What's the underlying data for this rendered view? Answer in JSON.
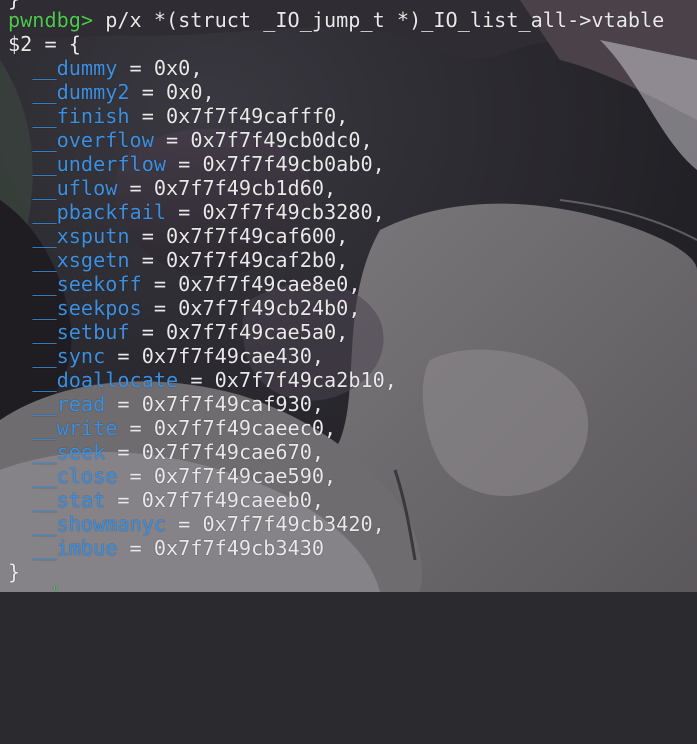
{
  "terminal": {
    "top_partial": "}",
    "prompt": "pwndbg>",
    "command": "p/x *(struct _IO_jump_t *)_IO_list_all->vtable",
    "result_open": "$2 = {",
    "fields": [
      {
        "name": "__dummy",
        "value": "0x0,"
      },
      {
        "name": "__dummy2",
        "value": "0x0,"
      },
      {
        "name": "__finish",
        "value": "0x7f7f49cafff0,"
      },
      {
        "name": "__overflow",
        "value": "0x7f7f49cb0dc0,"
      },
      {
        "name": "__underflow",
        "value": "0x7f7f49cb0ab0,"
      },
      {
        "name": "__uflow",
        "value": "0x7f7f49cb1d60,"
      },
      {
        "name": "__pbackfail",
        "value": "0x7f7f49cb3280,"
      },
      {
        "name": "__xsputn",
        "value": "0x7f7f49caf600,"
      },
      {
        "name": "__xsgetn",
        "value": "0x7f7f49caf2b0,"
      },
      {
        "name": "__seekoff",
        "value": "0x7f7f49cae8e0,"
      },
      {
        "name": "__seekpos",
        "value": "0x7f7f49cb24b0,"
      },
      {
        "name": "__setbuf",
        "value": "0x7f7f49cae5a0,"
      },
      {
        "name": "__sync",
        "value": "0x7f7f49cae430,"
      },
      {
        "name": "__doallocate",
        "value": "0x7f7f49ca2b10,"
      },
      {
        "name": "__read",
        "value": "0x7f7f49caf930,"
      },
      {
        "name": "__write",
        "value": "0x7f7f49caeec0,"
      },
      {
        "name": "__seek",
        "value": "0x7f7f49cae670,"
      },
      {
        "name": "__close",
        "value": "0x7f7f49cae590,"
      },
      {
        "name": "__stat",
        "value": "0x7f7f49caeeb0,"
      },
      {
        "name": "__showmanyc",
        "value": "0x7f7f49cb3420,"
      },
      {
        "name": "__imbue",
        "value": "0x7f7f49cb3430"
      }
    ],
    "result_close": "}",
    "equals": "=",
    "colors": {
      "prompt": "#4ec94e",
      "field_name": "#3d8fe0",
      "text": "#e9e9e9"
    }
  }
}
